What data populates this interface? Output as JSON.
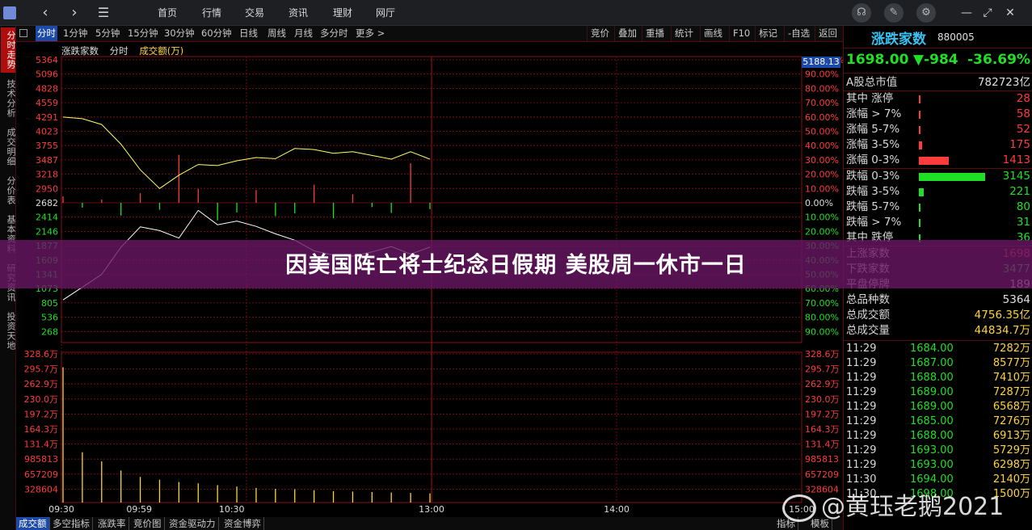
{
  "topbar": {
    "nav_back": "‹",
    "nav_forward": "›",
    "menu_icon": "menu-icon",
    "menu": [
      "首页",
      "行情",
      "交易",
      "资讯",
      "理财",
      "网厅"
    ],
    "icons": [
      "headset-icon",
      "wrench-icon",
      "gear-icon"
    ],
    "window": [
      "—",
      "⤢",
      "✕"
    ]
  },
  "left_tabs": [
    {
      "label": "分时走势",
      "active": true
    },
    {
      "label": "技术分析",
      "active": false
    },
    {
      "label": "成交明细",
      "active": false
    },
    {
      "label": "分价表",
      "active": false
    },
    {
      "label": "基本资料",
      "active": false
    },
    {
      "label": "研究资讯",
      "active": false
    },
    {
      "label": "投资天地",
      "active": false
    }
  ],
  "period_bar": {
    "items": [
      "分时",
      "1分钟",
      "5分钟",
      "15分钟",
      "30分钟",
      "60分钟",
      "日线",
      "周线",
      "月线",
      "多分时",
      "更多 >"
    ],
    "active": "分时",
    "right_items": [
      "竞价",
      "叠加",
      "重播",
      "统计",
      "画线",
      "F10",
      "标记",
      "-自选",
      "返回"
    ]
  },
  "chart_legend": {
    "name": "涨跌家数",
    "mode": "分时",
    "indicator": "成交额(万)",
    "last_value_tag": "5188.13"
  },
  "chart_data": {
    "type": "line",
    "y_left_ticks": [
      "5364",
      "5096",
      "4828",
      "4559",
      "4291",
      "4023",
      "3755",
      "3487",
      "3218",
      "2950",
      "2682",
      "2414",
      "2146",
      "1877",
      "1609",
      "1341",
      "1073",
      "805",
      "536",
      "268"
    ],
    "y_right_ticks": [
      "100.00%",
      "90.00%",
      "80.00%",
      "70.00%",
      "60.00%",
      "50.00%",
      "40.00%",
      "30.00%",
      "20.00%",
      "10.00%",
      "0.00%",
      "10.00%",
      "20.00%",
      "30.00%",
      "40.00%",
      "50.00%",
      "60.00%",
      "70.00%",
      "80.00%",
      "90.00%"
    ],
    "volume_ticks_left": [
      "328.6万",
      "295.7万",
      "262.9万",
      "230.0万",
      "197.2万",
      "164.3万",
      "131.4万",
      "985813",
      "657209",
      "328604"
    ],
    "volume_ticks_right": [
      "328.6万",
      "295.7万",
      "262.9万",
      "230.0万",
      "197.2万",
      "164.3万",
      "131.4万",
      "985813",
      "657209",
      "328604"
    ],
    "x_ticks": [
      "09:30",
      "09:59",
      "10:30",
      "13:00",
      "14:00",
      "15:00"
    ],
    "baseline": 2682,
    "series": [
      {
        "name": "",
        "values": [
          4290,
          4260,
          4150,
          3780,
          3300,
          2950,
          3200,
          3400,
          3380,
          3470,
          3530,
          3510,
          3700,
          3680,
          3610,
          3640,
          3570,
          3500,
          3640,
          3500
        ]
      },
      {
        "name": "",
        "values": [
          860,
          1100,
          1340,
          1850,
          2230,
          2160,
          2020,
          2540,
          2270,
          2340,
          2240,
          2100,
          1980,
          1780,
          1700,
          1680,
          1760,
          1860,
          1720,
          1850
        ]
      }
    ],
    "diff_bars": [
      120,
      -90,
      60,
      -240,
      180,
      -130,
      900,
      260,
      -330,
      -180,
      240,
      -250,
      -200,
      340,
      -290,
      160,
      -80,
      -190,
      740,
      -120
    ],
    "volume": [
      2960000,
      1100000,
      900000,
      700000,
      560000,
      500000,
      450000,
      420000,
      380000,
      350000,
      320000,
      300000,
      290000,
      270000,
      250000,
      240000,
      230000,
      220000,
      210000,
      200000
    ]
  },
  "right_panel": {
    "name": "涨跌家数",
    "code": "880005",
    "price": "1698.00",
    "change": "▼-984",
    "pct": "-36.69%",
    "stats": [
      {
        "label": "A股总市值",
        "value": "782723亿",
        "color": "#e0e0e0",
        "bar": 0,
        "bar_color": ""
      },
      {
        "label": "其中 涨停",
        "value": "28",
        "color": "#ff3b3b",
        "bar": 0.005,
        "bar_color": "#ff3b3b"
      },
      {
        "label": "涨幅 > 7%",
        "value": "58",
        "color": "#ff3b3b",
        "bar": 0.01,
        "bar_color": "#ff3b3b"
      },
      {
        "label": "涨幅 5-7%",
        "value": "52",
        "color": "#ff3b3b",
        "bar": 0.01,
        "bar_color": "#ff3b3b"
      },
      {
        "label": "涨幅 3-5%",
        "value": "175",
        "color": "#ff3b3b",
        "bar": 0.05,
        "bar_color": "#ff3b3b"
      },
      {
        "label": "涨幅 0-3%",
        "value": "1413",
        "color": "#ff3b3b",
        "bar": 0.45,
        "bar_color": "#ff3b3b"
      },
      {
        "label": "跌幅 0-3%",
        "value": "3145",
        "color": "#1ee024",
        "bar": 1.0,
        "bar_color": "#1ee024"
      },
      {
        "label": "跌幅 3-5%",
        "value": "221",
        "color": "#1ee024",
        "bar": 0.07,
        "bar_color": "#1ee024"
      },
      {
        "label": "跌幅 5-7%",
        "value": "80",
        "color": "#1ee024",
        "bar": 0.03,
        "bar_color": "#1ee024"
      },
      {
        "label": "跌幅 > 7%",
        "value": "31",
        "color": "#1ee024",
        "bar": 0.01,
        "bar_color": "#1ee024"
      },
      {
        "label": "其中 跌停",
        "value": "36",
        "color": "#1ee024",
        "bar": 0.01,
        "bar_color": "#1ee024"
      },
      {
        "label": "上涨家数",
        "value": "1698",
        "color": "#ff3b3b",
        "bar": 0,
        "bar_color": ""
      },
      {
        "label": "下跌家数",
        "value": "3477",
        "color": "#1ee024",
        "bar": 0,
        "bar_color": ""
      },
      {
        "label": "平盘停牌",
        "value": "189",
        "color": "#e0e0e0",
        "bar": 0,
        "bar_color": ""
      },
      {
        "label": "总品种数",
        "value": "5364",
        "color": "#e0e0e0",
        "bar": 0,
        "bar_color": ""
      },
      {
        "label": "总成交额",
        "value": "4756.35亿",
        "color": "#ffd23c",
        "bar": 0,
        "bar_color": ""
      },
      {
        "label": "总成交量",
        "value": "44834.7万",
        "color": "#ffd23c",
        "bar": 0,
        "bar_color": ""
      }
    ],
    "ticks": [
      {
        "time": "11:29",
        "price": "1684.00",
        "vol": "7282万"
      },
      {
        "time": "11:29",
        "price": "1687.00",
        "vol": "8577万"
      },
      {
        "time": "11:29",
        "price": "1688.00",
        "vol": "7410万"
      },
      {
        "time": "11:29",
        "price": "1689.00",
        "vol": "7287万"
      },
      {
        "time": "11:29",
        "price": "1689.00",
        "vol": "6568万"
      },
      {
        "time": "11:29",
        "price": "1685.00",
        "vol": "7276万"
      },
      {
        "time": "11:29",
        "price": "1688.00",
        "vol": "6913万"
      },
      {
        "time": "11:29",
        "price": "1693.00",
        "vol": "5729万"
      },
      {
        "time": "11:29",
        "price": "1693.00",
        "vol": "6298万"
      },
      {
        "time": "11:30",
        "price": "1694.00",
        "vol": "2140万"
      },
      {
        "time": "11:30",
        "price": "1698.00",
        "vol": "1500万"
      }
    ]
  },
  "bottom_tabs": [
    "成交额",
    "多空指标",
    "涨跌率",
    "竞价图",
    "资金驱动力",
    "资金博弈"
  ],
  "bottom_right": [
    "指标",
    "模板"
  ],
  "banner": {
    "text": "因美国阵亡将士纪念日假期 美股周一休市一日"
  },
  "watermark": {
    "text": "@黄珏老鹅2021",
    "icon": "weibo-icon"
  },
  "colors": {
    "up": "#ff3b3b",
    "down": "#1ee024",
    "grid": "#8a1010",
    "line_yellow": "#ffff66",
    "line_white": "#ffffff",
    "accent_blue": "#1d4aa8",
    "banner": "#691664"
  }
}
